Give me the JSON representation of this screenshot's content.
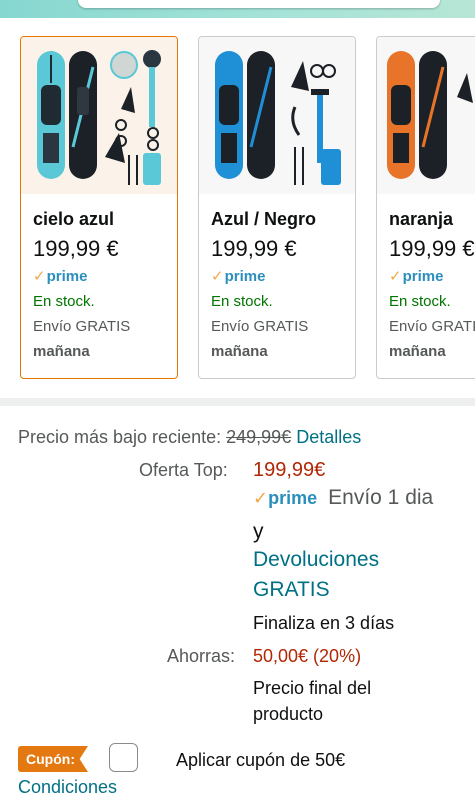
{
  "colors": {
    "accent": "#e77600",
    "link": "#007185",
    "price_red": "#b12704",
    "stock_green": "#007600",
    "prime_blue": "#2a8fbd",
    "coupon_orange": "#e47911"
  },
  "variants": [
    {
      "name": "cielo azul",
      "price": "199,99 €",
      "prime": "prime",
      "stock": "En stock.",
      "shipping": "Envío GRATIS",
      "delivery": "mañana",
      "selected": true
    },
    {
      "name": "Azul / Negro",
      "price": "199,99 €",
      "prime": "prime",
      "stock": "En stock.",
      "shipping": "Envío GRATIS",
      "delivery": "mañana",
      "selected": false
    },
    {
      "name": "naranja",
      "price": "199,99 €",
      "prime": "prime",
      "stock": "En stock.",
      "shipping": "Envío GRATIS",
      "delivery": "mañana",
      "selected": false
    }
  ],
  "pricing": {
    "lowest_label": "Precio más bajo reciente:",
    "lowest_price": "249,99€",
    "details_link": "Detalles",
    "offer_label": "Oferta Top:",
    "offer_price": "199,99€",
    "prime": "prime",
    "delivery_line1": "Envío 1 dia",
    "delivery_line2": "y",
    "returns_line1": "Devoluciones",
    "returns_line2": "GRATIS",
    "ends": "Finaliza en 3 días",
    "savings_label": "Ahorras:",
    "savings_value": "50,00€ (20%)",
    "final_line1": "Precio final del",
    "final_line2": "producto"
  },
  "coupon": {
    "badge": "Cupón:",
    "text": "Aplicar cupón de 50€",
    "conditions_link": "Condiciones"
  }
}
